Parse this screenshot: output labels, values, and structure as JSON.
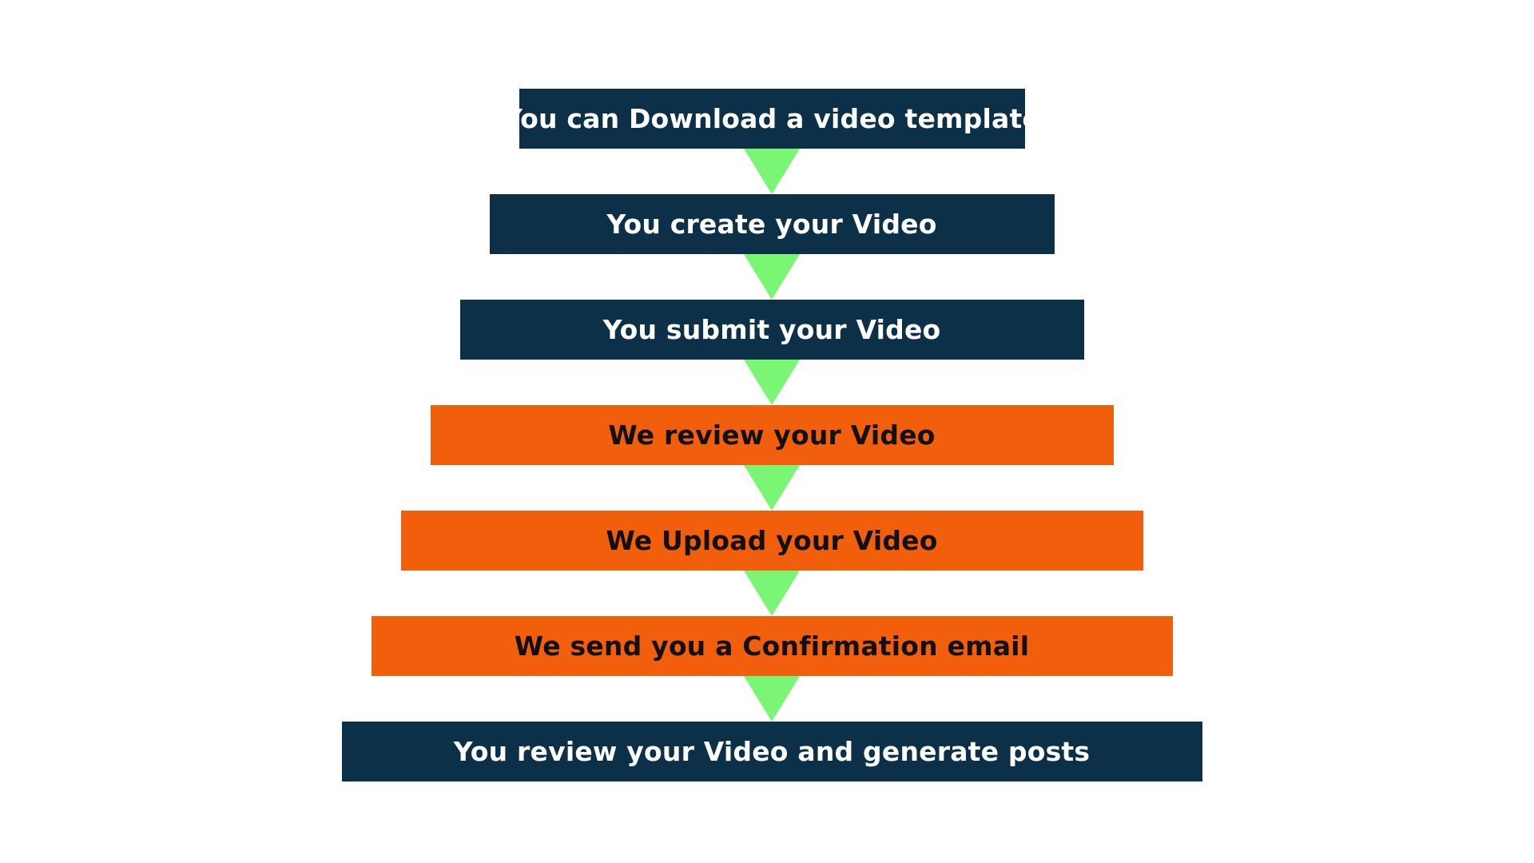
{
  "diagram": {
    "colors": {
      "background": "#ffffff",
      "dark_step": "#0c3047",
      "dark_text": "#ffffff",
      "orange_step": "#f25f0c",
      "orange_text": "#111111",
      "arrow": "#7bf574"
    },
    "steps": [
      {
        "label": "You can Download a video template",
        "style": "dark"
      },
      {
        "label": "You create your Video",
        "style": "dark"
      },
      {
        "label": "You submit your Video",
        "style": "dark"
      },
      {
        "label": "We review your Video",
        "style": "orange"
      },
      {
        "label": "We Upload your Video",
        "style": "orange"
      },
      {
        "label": "We send you a Confirmation email",
        "style": "orange"
      },
      {
        "label": "You review your Video and generate posts",
        "style": "dark"
      }
    ],
    "connector_icon": "down-triangle-icon"
  }
}
